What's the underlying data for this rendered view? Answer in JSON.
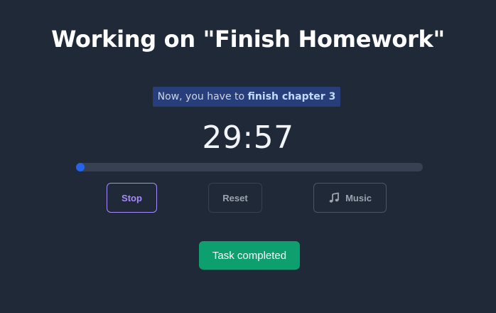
{
  "header": {
    "title": "Working on \"Finish Homework\""
  },
  "instruction": {
    "prefix": "Now, you have to ",
    "task": "finish chapter 3"
  },
  "timer": {
    "display": "29:57"
  },
  "progress": {
    "fraction": 0.002,
    "color": "#2563eb"
  },
  "controls": {
    "stop_label": "Stop",
    "reset_label": "Reset",
    "music_label": "Music",
    "music_icon": "music-note-icon"
  },
  "actions": {
    "complete_label": "Task completed"
  },
  "colors": {
    "background": "#1f2937",
    "accent_purple": "#a78bfa",
    "success_green": "#0d9f6e"
  }
}
